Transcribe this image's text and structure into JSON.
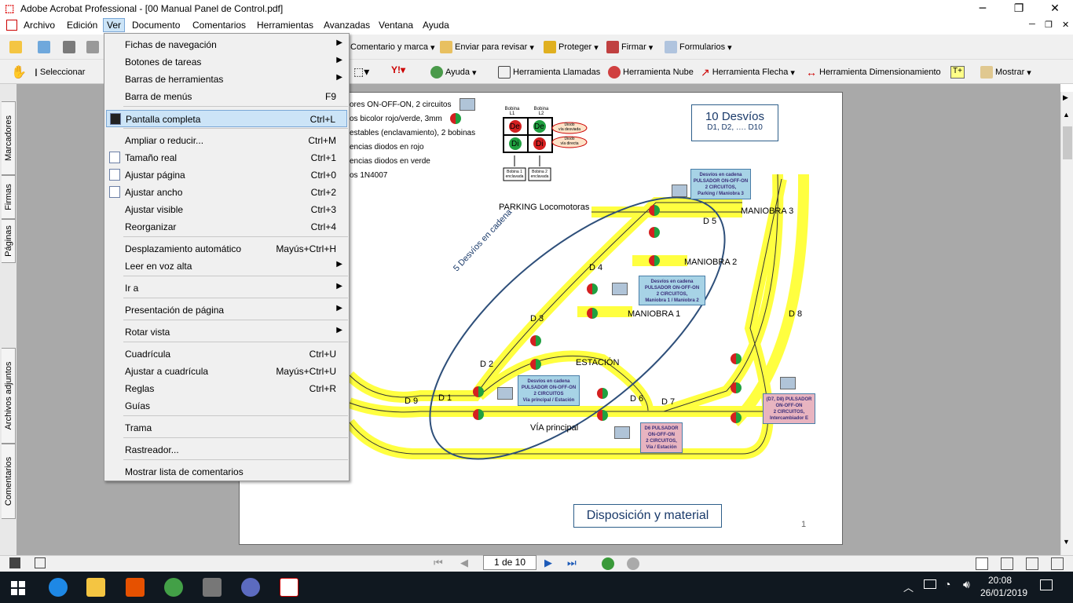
{
  "window": {
    "title": "Adobe Acrobat Professional - [00 Manual Panel de Control.pdf]",
    "app_icon": "acrobat-icon"
  },
  "menubar": [
    "Archivo",
    "Edición",
    "Ver",
    "Documento",
    "Comentarios",
    "Herramientas",
    "Avanzadas",
    "Ventana",
    "Ayuda"
  ],
  "toolbar1": {
    "comment": "Comentario y marca",
    "review": "Enviar para revisar",
    "protect": "Proteger",
    "sign": "Firmar",
    "forms": "Formularios"
  },
  "toolbar2": {
    "select": "Seleccionar",
    "help": "Ayuda",
    "callout": "Herramienta Llamadas",
    "cloud": "Herramienta Nube",
    "arrow": "Herramienta Flecha",
    "dimension": "Herramienta Dimensionamiento",
    "show": "Mostrar"
  },
  "left_tabs": [
    "Marcadores",
    "Firmas",
    "Páginas",
    "Archivos adjuntos",
    "Comentarios"
  ],
  "ver_menu": [
    {
      "label": "Fichas de navegación",
      "shortcut": "",
      "submenu": true
    },
    {
      "label": "Botones de tareas",
      "shortcut": "",
      "submenu": true
    },
    {
      "label": "Barras de herramientas",
      "shortcut": "",
      "submenu": true
    },
    {
      "label": "Barra de menús",
      "shortcut": "F9",
      "submenu": false
    },
    {
      "label": "Pantalla completa",
      "shortcut": "Ctrl+L",
      "submenu": false
    },
    {
      "label": "Ampliar o reducir...",
      "shortcut": "Ctrl+M",
      "submenu": false
    },
    {
      "label": "Tamaño real",
      "shortcut": "Ctrl+1",
      "submenu": false
    },
    {
      "label": "Ajustar página",
      "shortcut": "Ctrl+0",
      "submenu": false
    },
    {
      "label": "Ajustar ancho",
      "shortcut": "Ctrl+2",
      "submenu": false
    },
    {
      "label": "Ajustar visible",
      "shortcut": "Ctrl+3",
      "submenu": false
    },
    {
      "label": "Reorganizar",
      "shortcut": "Ctrl+4",
      "submenu": false
    },
    {
      "label": "Desplazamiento automático",
      "shortcut": "Mayús+Ctrl+H",
      "submenu": false
    },
    {
      "label": "Leer en voz alta",
      "shortcut": "",
      "submenu": true
    },
    {
      "label": "Ir a",
      "shortcut": "",
      "submenu": true
    },
    {
      "label": "Presentación de página",
      "shortcut": "",
      "submenu": true
    },
    {
      "label": "Rotar vista",
      "shortcut": "",
      "submenu": true
    },
    {
      "label": "Cuadrícula",
      "shortcut": "Ctrl+U",
      "submenu": false
    },
    {
      "label": "Ajustar a cuadrícula",
      "shortcut": "Mayús+Ctrl+U",
      "submenu": false
    },
    {
      "label": "Reglas",
      "shortcut": "Ctrl+R",
      "submenu": false
    },
    {
      "label": "Guías",
      "shortcut": "",
      "submenu": false
    },
    {
      "label": "Trama",
      "shortcut": "",
      "submenu": false
    },
    {
      "label": "Rastreador...",
      "shortcut": "",
      "submenu": false
    },
    {
      "label": "Mostrar lista de comentarios",
      "shortcut": "",
      "submenu": false
    }
  ],
  "pdf": {
    "legend_lines": [
      "ores ON-OFF-ON, 2 circuitos",
      "os bicolor rojo/verde, 3mm",
      "estables (enclavamiento), 2 bobinas",
      "encias diodos en rojo",
      "encias diodos en verde",
      "os 1N4007"
    ],
    "title_box": {
      "title": "10 Desvíos",
      "sub": "D1, D2, …. D10"
    },
    "diagram": {
      "bobina_l1": "Bobina\nL1",
      "bobina_l2": "Bobina\nL2",
      "cells": [
        "De",
        "De",
        "Di",
        "Di"
      ],
      "diodo_desviada": "Diodo\nvía desviada",
      "diodo_directa": "Diodo\nvía directa",
      "bobina1": "Bobina 1\nenclavada",
      "bobina2": "Bobina 2\nenclavada"
    },
    "labels": {
      "parking": "PARKING Locomotoras",
      "maniobra3": "MANIOBRA 3",
      "maniobra2": "MANIOBRA 2",
      "maniobra1": "MANIOBRA 1",
      "estacion": "ESTACIÓN",
      "via_principal": "VÍA principal",
      "cadena": "5 Desvíos en cadena",
      "d1": "D 1",
      "d2": "D 2",
      "d3": "D 3",
      "d4": "D 4",
      "d5": "D 5",
      "d6": "D 6",
      "d7": "D 7",
      "d8": "D 8",
      "d9": "D 9"
    },
    "notes": {
      "n1": "Desvíos en cadena\nPULSADOR ON-OFF-ON\n2 CIRCUITOS,\nParking / Maniobra 3",
      "n2": "Desvíos en cadena\nPULSADOR ON-OFF-ON\n2 CIRCUITOS,\nManiobra 1 / Maniobra 2",
      "n3": "Desvíos en cadena\nPULSADOR ON-OFF-ON\n2 CIRCUITOS\nVía principal / Estación",
      "n4": "D6 PULSADOR\nON-OFF-ON\n2 CIRCUITOS,\nVía / Estación",
      "n5": "(D7, D8) PULSADOR\nON-OFF-ON\n2 CIRCUITOS,\nIntercambiador E"
    },
    "footer_box": "Disposición y material",
    "page_num": "1"
  },
  "status": {
    "page": "1 de 10"
  },
  "taskbar": {
    "time": "20:08",
    "date": "26/01/2019"
  }
}
